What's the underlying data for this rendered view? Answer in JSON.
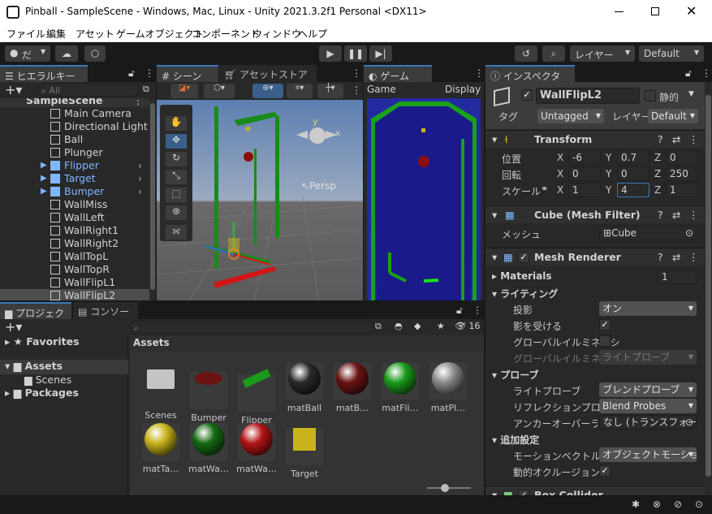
{
  "window": {
    "title": "Pinball - SampleScene - Windows, Mac, Linux - Unity 2021.3.2f1 Personal <DX11>"
  },
  "menu": [
    "ファイル",
    "編集",
    "アセット",
    "ゲームオブジェクト",
    "コンポーネント",
    "ウィンドウ",
    "ヘルプ"
  ],
  "toolbar": {
    "account": "だ",
    "layers": "レイヤー",
    "layout": "Default"
  },
  "hierarchy": {
    "tab": "ヒエラルキー",
    "search_placeholder": "All",
    "scene": "SampleScene",
    "items": [
      {
        "label": "Main Camera",
        "prefab": false
      },
      {
        "label": "Directional Light",
        "prefab": false
      },
      {
        "label": "Ball",
        "prefab": false
      },
      {
        "label": "Plunger",
        "prefab": false
      },
      {
        "label": "Flipper",
        "prefab": true
      },
      {
        "label": "Target",
        "prefab": true
      },
      {
        "label": "Bumper",
        "prefab": true
      },
      {
        "label": "WallMiss",
        "prefab": false
      },
      {
        "label": "WallLeft",
        "prefab": false
      },
      {
        "label": "WallRight1",
        "prefab": false
      },
      {
        "label": "WallRight2",
        "prefab": false
      },
      {
        "label": "WallTopL",
        "prefab": false
      },
      {
        "label": "WallTopR",
        "prefab": false
      },
      {
        "label": "WallFlipL1",
        "prefab": false
      },
      {
        "label": "WallFlipL2",
        "prefab": false
      }
    ]
  },
  "scene_view": {
    "tab": "シーン",
    "tab2": "アセットストア",
    "persp": "Persp"
  },
  "game_view": {
    "tab": "ゲーム",
    "mode": "Game",
    "display": "Display"
  },
  "project": {
    "tab": "プロジェクト",
    "tab2": "コンソール",
    "hidden_count": "16",
    "favorites": "Favorites",
    "assets_root": "Assets",
    "scenes": "Scenes",
    "packages": "Packages",
    "breadcrumb": "Assets",
    "assets": [
      {
        "label": "Scenes",
        "kind": "folder"
      },
      {
        "label": "Bumper",
        "kind": "bumper"
      },
      {
        "label": "Flipper",
        "kind": "flipper"
      },
      {
        "label": "matBall",
        "kind": "sphere",
        "color": "#2a2a2a"
      },
      {
        "label": "matB…",
        "kind": "sphere",
        "color": "#6b1414"
      },
      {
        "label": "matFli…",
        "kind": "sphere",
        "color": "#1a9a1a"
      },
      {
        "label": "matPl…",
        "kind": "sphere",
        "color": "#8a8a8a"
      },
      {
        "label": "matTa…",
        "kind": "sphere",
        "color": "#c8b41a"
      },
      {
        "label": "matWa…",
        "kind": "sphere",
        "color": "#146b14"
      },
      {
        "label": "matWa…",
        "kind": "sphere",
        "color": "#b41414"
      },
      {
        "label": "Target",
        "kind": "cube"
      }
    ]
  },
  "inspector": {
    "tab": "インスペクター",
    "object_name": "WallFlipL2",
    "static_label": "静的",
    "tag_label": "タグ",
    "tag_value": "Untagged",
    "layer_label": "レイヤー",
    "layer_value": "Default",
    "transform": {
      "title": "Transform",
      "position_label": "位置",
      "rotation_label": "回転",
      "scale_label": "スケール",
      "position": {
        "x": "-6",
        "y": "0.7",
        "z": "0"
      },
      "rotation": {
        "x": "0",
        "y": "0",
        "z": "250"
      },
      "scale": {
        "x": "1",
        "y": "4",
        "z": "1"
      }
    },
    "mesh_filter": {
      "title": "Cube (Mesh Filter)",
      "mesh_label": "メッシュ",
      "mesh_value": "Cube"
    },
    "mesh_renderer": {
      "title": "Mesh Renderer",
      "materials_label": "Materials",
      "materials_count": "1",
      "lighting": "ライティング",
      "cast_shadows_label": "投影",
      "cast_shadows_value": "オン",
      "receive_shadows_label": "影を受ける",
      "gi_label": "グローバルイルミネーシ",
      "gi2_label": "グローバルイルミネーシ",
      "gi2_value": "ライトプローブ",
      "probes": "プローブ",
      "light_probes_label": "ライトプローブ",
      "light_probes_value": "ブレンドプローブ",
      "reflection_label": "リフレクションプローブ",
      "reflection_value": "Blend Probes",
      "anchor_label": "アンカーオーバーライド",
      "anchor_value": "なし (トランスフォーム",
      "additional": "追加設定",
      "motion_label": "モーションベクトル",
      "motion_value": "オブジェクトモーションベ",
      "occlusion_label": "動的オクルージョン"
    },
    "box_collider": {
      "title": "Box Collider"
    }
  }
}
